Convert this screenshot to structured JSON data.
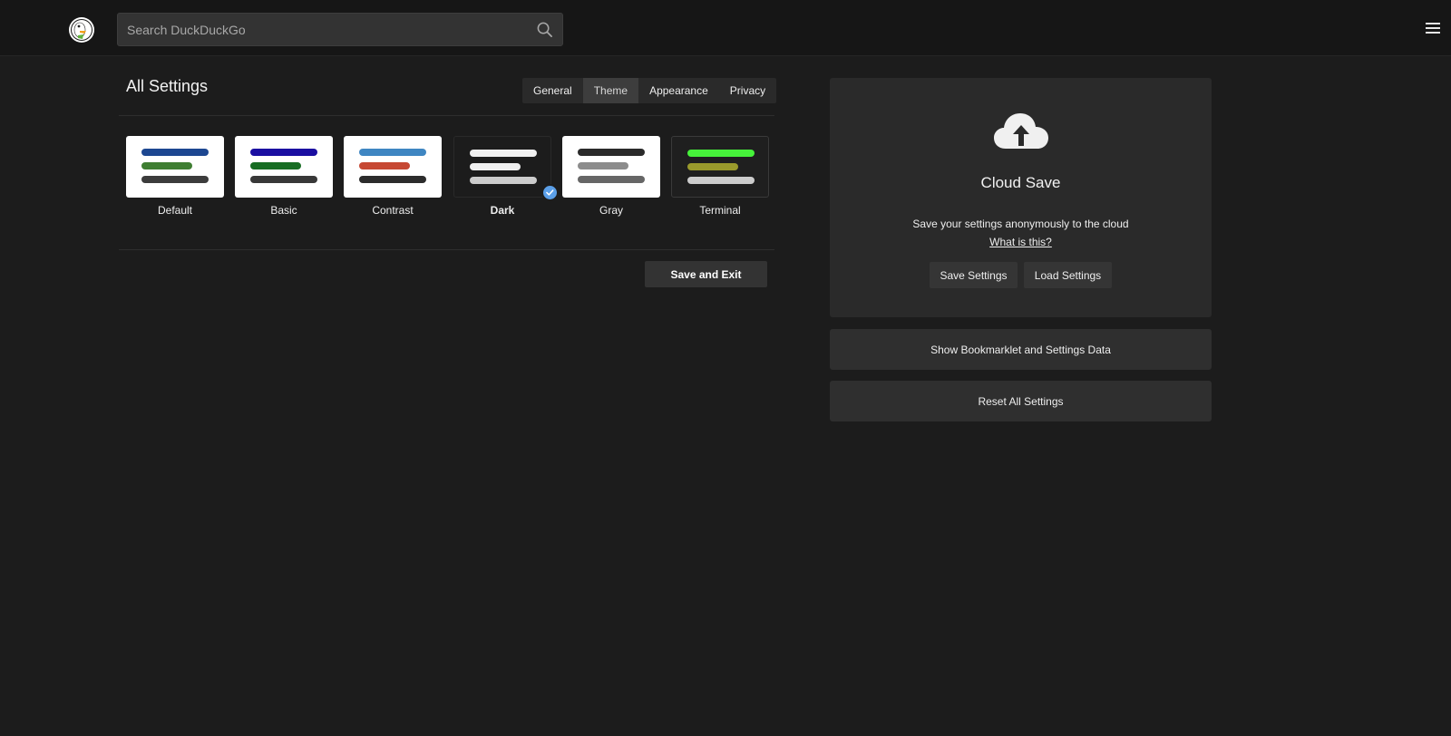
{
  "header": {
    "logo_icon": "duckduckgo-logo",
    "search_placeholder": "Search DuckDuckGo",
    "search_icon": "search-icon",
    "menu_icon": "hamburger-menu-icon"
  },
  "settings": {
    "title": "All Settings",
    "tabs": [
      {
        "label": "General",
        "active": false
      },
      {
        "label": "Theme",
        "active": true
      },
      {
        "label": "Appearance",
        "active": false
      },
      {
        "label": "Privacy",
        "active": false
      }
    ],
    "themes": [
      {
        "label": "Default",
        "bg": "#ffffff",
        "bars": [
          "#1d4791",
          "#3f7e32",
          "#3c3c3c"
        ],
        "selected": false
      },
      {
        "label": "Basic",
        "bg": "#ffffff",
        "bars": [
          "#1a0ea1",
          "#176d23",
          "#383838"
        ],
        "selected": false
      },
      {
        "label": "Contrast",
        "bg": "#ffffff",
        "bars": [
          "#3f86c2",
          "#c64833",
          "#2c2c2c"
        ],
        "selected": false
      },
      {
        "label": "Dark",
        "bg": "#1c1c1c",
        "bars": [
          "#f0f0f0",
          "#f0f0f0",
          "#cccccc"
        ],
        "selected": true
      },
      {
        "label": "Gray",
        "bg": "#ffffff",
        "bars": [
          "#2a2a2a",
          "#8c8c8c",
          "#666666"
        ],
        "selected": false
      },
      {
        "label": "Terminal",
        "bg": "#1f1f1f",
        "bars": [
          "#46f23a",
          "#9a9a2c",
          "#cccccc"
        ],
        "selected": false
      }
    ],
    "save_exit_label": "Save and Exit"
  },
  "cloud": {
    "icon": "cloud-upload-icon",
    "title": "Cloud Save",
    "description": "Save your settings anonymously to the cloud",
    "link": "What is this?",
    "save_label": "Save Settings",
    "load_label": "Load Settings"
  },
  "actions": {
    "bookmarklet_label": "Show Bookmarklet and Settings Data",
    "reset_label": "Reset All Settings"
  }
}
